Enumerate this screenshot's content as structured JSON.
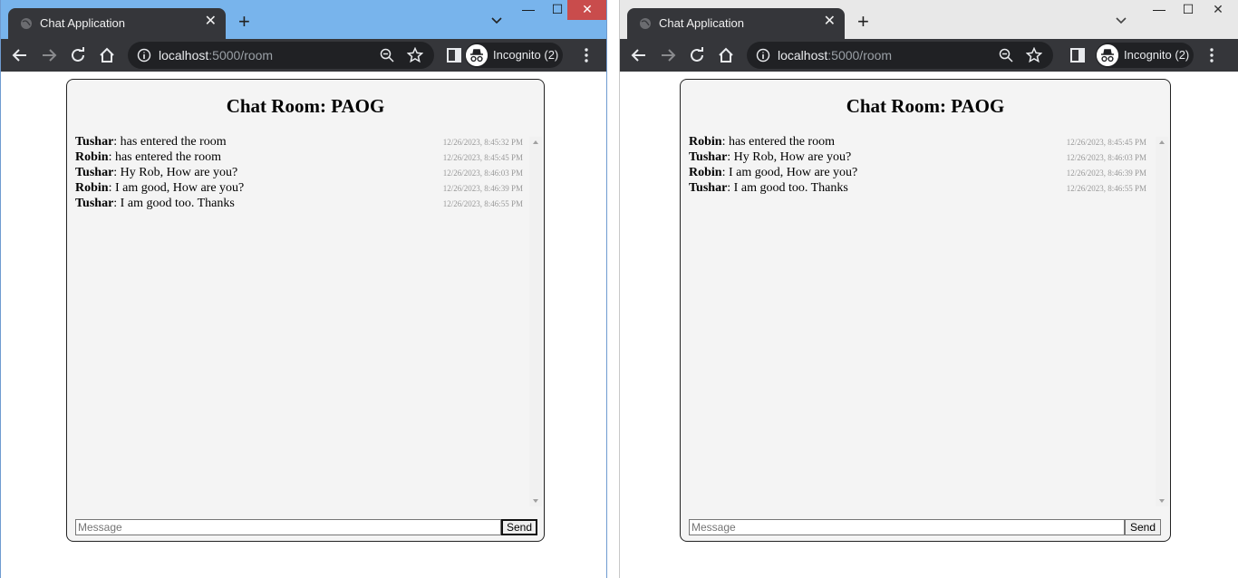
{
  "windows": [
    {
      "tab_title": "Chat Application",
      "url_host": "localhost",
      "url_path": ":5000/room",
      "incognito_label": "Incognito (2)",
      "room_title": "Chat Room: PAOG",
      "messages": [
        {
          "sender": "Tushar",
          "text": ": has entered the room",
          "time": "12/26/2023, 8:45:32 PM"
        },
        {
          "sender": "Robin",
          "text": ": has entered the room",
          "time": "12/26/2023, 8:45:45 PM"
        },
        {
          "sender": "Tushar",
          "text": ": Hy Rob, How are you?",
          "time": "12/26/2023, 8:46:03 PM"
        },
        {
          "sender": "Robin",
          "text": ": I am good, How are you?",
          "time": "12/26/2023, 8:46:39 PM"
        },
        {
          "sender": "Tushar",
          "text": ": I am good too. Thanks",
          "time": "12/26/2023, 8:46:55 PM"
        }
      ],
      "message_placeholder": "Message",
      "send_label": "Send"
    },
    {
      "tab_title": "Chat Application",
      "url_host": "localhost",
      "url_path": ":5000/room",
      "incognito_label": "Incognito (2)",
      "room_title": "Chat Room: PAOG",
      "messages": [
        {
          "sender": "Robin",
          "text": ": has entered the room",
          "time": "12/26/2023, 8:45:45 PM"
        },
        {
          "sender": "Tushar",
          "text": ": Hy Rob, How are you?",
          "time": "12/26/2023, 8:46:03 PM"
        },
        {
          "sender": "Robin",
          "text": ": I am good, How are you?",
          "time": "12/26/2023, 8:46:39 PM"
        },
        {
          "sender": "Tushar",
          "text": ": I am good too. Thanks",
          "time": "12/26/2023, 8:46:55 PM"
        }
      ],
      "message_placeholder": "Message",
      "send_label": "Send"
    }
  ],
  "window_controls": {
    "minimize": "—",
    "maximize": "☐",
    "close": "✕"
  },
  "new_tab_label": "+",
  "tab_close_label": "✕",
  "icons": [
    "globe-icon",
    "back-icon",
    "forward-icon",
    "reload-icon",
    "home-icon",
    "info-icon",
    "zoom-icon",
    "star-icon",
    "side-panel-icon",
    "incognito-icon",
    "menu-icon"
  ],
  "colors": {
    "left_frame": "#78b4ec",
    "right_frame": "#e8e8e8",
    "toolbar": "#35363a",
    "close_red": "#c94c4c",
    "chat_bg": "#f4f4f4"
  }
}
